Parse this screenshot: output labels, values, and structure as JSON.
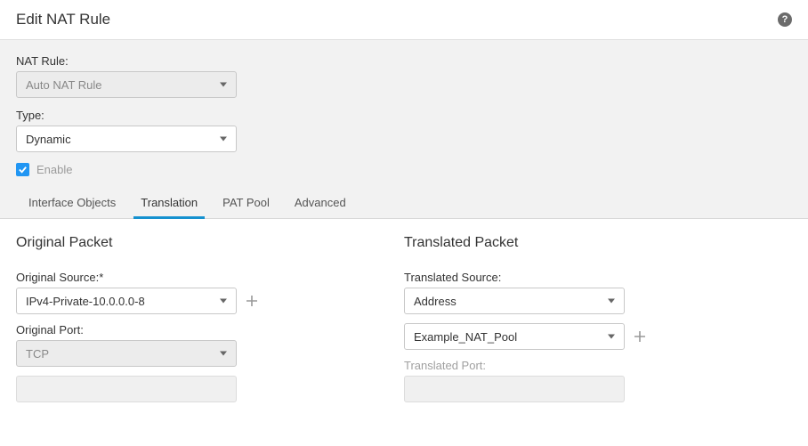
{
  "header": {
    "title": "Edit NAT Rule"
  },
  "upper": {
    "nat_rule_label": "NAT Rule:",
    "nat_rule_value": "Auto NAT Rule",
    "type_label": "Type:",
    "type_value": "Dynamic",
    "enable_label": "Enable"
  },
  "tabs": [
    {
      "label": "Interface Objects"
    },
    {
      "label": "Translation"
    },
    {
      "label": "PAT Pool"
    },
    {
      "label": "Advanced"
    }
  ],
  "original": {
    "title": "Original Packet",
    "source_label": "Original Source:*",
    "source_value": "IPv4-Private-10.0.0.0-8",
    "port_label": "Original Port:",
    "port_value": "TCP"
  },
  "translated": {
    "title": "Translated Packet",
    "source_label": "Translated Source:",
    "source_value": "Address",
    "pool_value": "Example_NAT_Pool",
    "port_label": "Translated Port:"
  }
}
